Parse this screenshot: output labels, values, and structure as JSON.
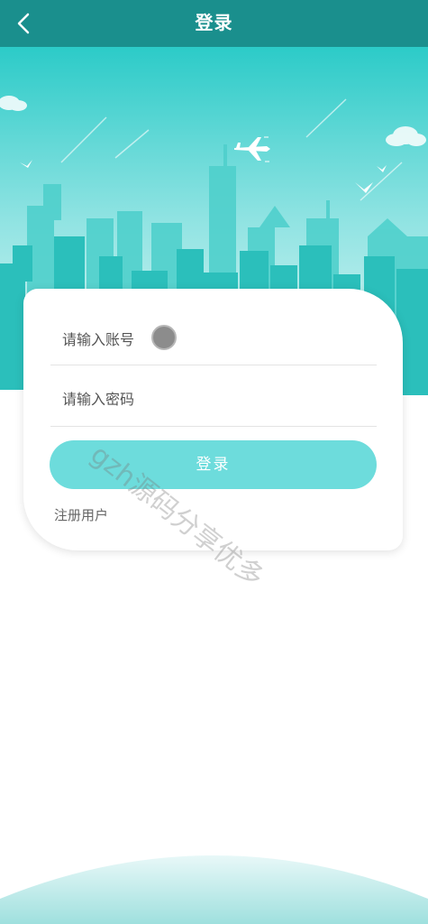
{
  "topbar": {
    "title": "登录",
    "back_icon": "chevron-left-icon"
  },
  "form": {
    "account_placeholder": "请输入账号",
    "password_placeholder": "请输入密码",
    "login_label": "登录",
    "register_label": "注册用户"
  },
  "watermark": {
    "text": "gzh源码分享优多"
  },
  "colors": {
    "header": "#1a8f8d",
    "sky_top": "#29c9c6",
    "sky_bottom": "#c8f1f0",
    "button": "#6ddcdc",
    "buildings": "#2bbfbb"
  }
}
